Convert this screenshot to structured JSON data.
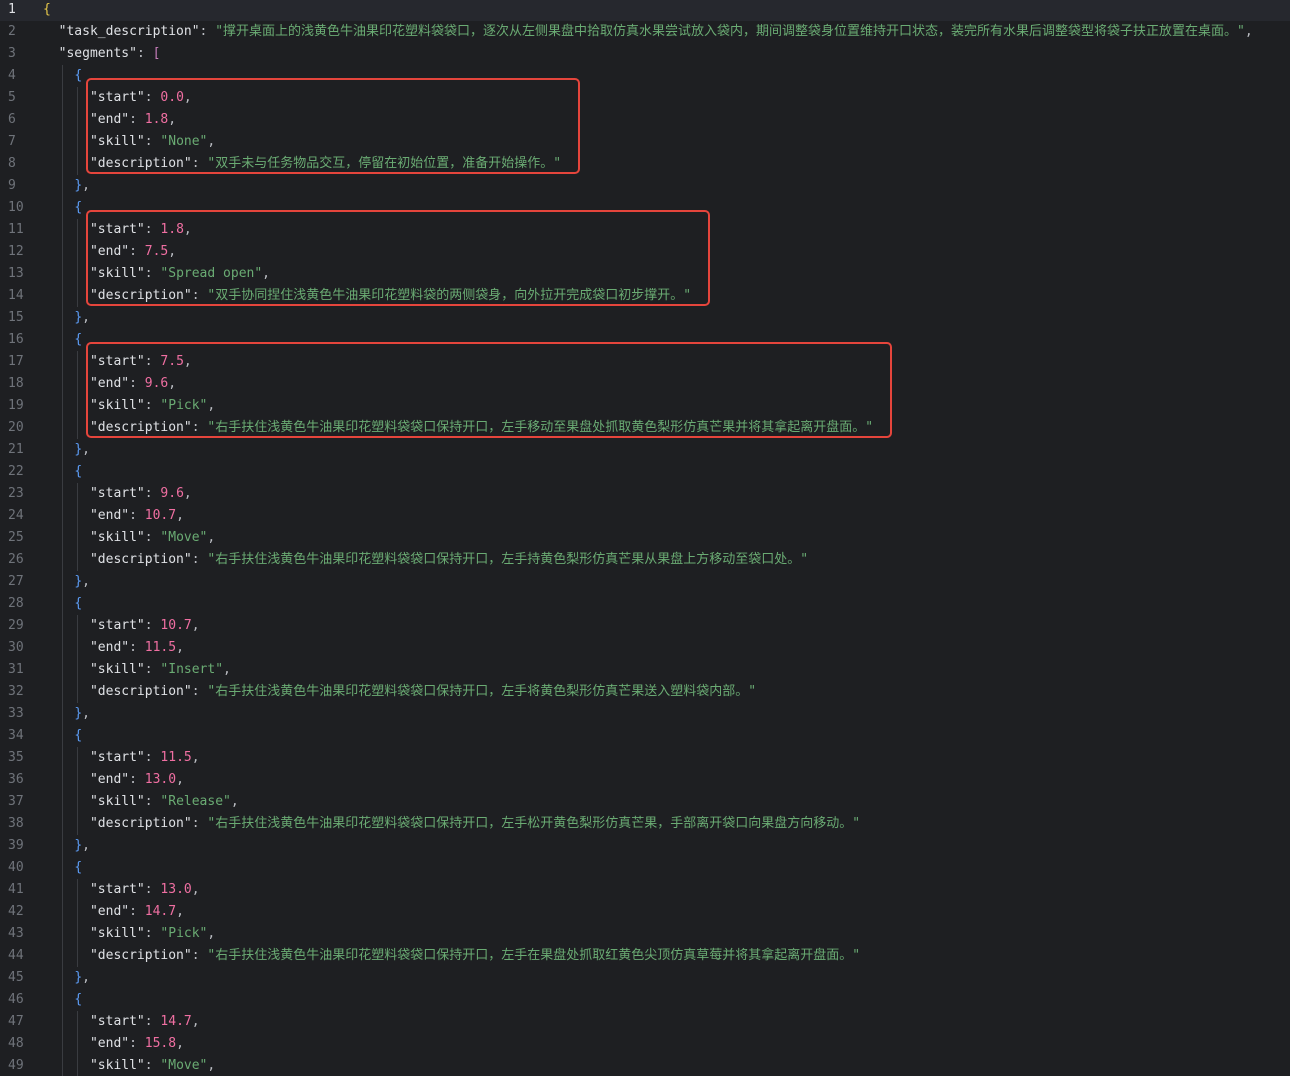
{
  "file": {
    "task_description_key": "task_description",
    "task_description": "撑开桌面上的浅黄色牛油果印花塑料袋袋口，逐次从左侧果盘中拾取仿真水果尝试放入袋内，期间调整袋身位置维持开口状态，装完所有水果后调整袋型将袋子扶正放置在桌面。",
    "segments_key": "segments",
    "segments": [
      {
        "start": "0.0",
        "end": "1.8",
        "skill": "None",
        "description": "双手未与任务物品交互，停留在初始位置，准备开始操作。"
      },
      {
        "start": "1.8",
        "end": "7.5",
        "skill": "Spread open",
        "description": "双手协同捏住浅黄色牛油果印花塑料袋的两侧袋身，向外拉开完成袋口初步撑开。"
      },
      {
        "start": "7.5",
        "end": "9.6",
        "skill": "Pick",
        "description": "右手扶住浅黄色牛油果印花塑料袋袋口保持开口，左手移动至果盘处抓取黄色梨形仿真芒果并将其拿起离开盘面。"
      },
      {
        "start": "9.6",
        "end": "10.7",
        "skill": "Move",
        "description": "右手扶住浅黄色牛油果印花塑料袋袋口保持开口，左手持黄色梨形仿真芒果从果盘上方移动至袋口处。"
      },
      {
        "start": "10.7",
        "end": "11.5",
        "skill": "Insert",
        "description": "右手扶住浅黄色牛油果印花塑料袋袋口保持开口，左手将黄色梨形仿真芒果送入塑料袋内部。"
      },
      {
        "start": "11.5",
        "end": "13.0",
        "skill": "Release",
        "description": "右手扶住浅黄色牛油果印花塑料袋袋口保持开口，左手松开黄色梨形仿真芒果，手部离开袋口向果盘方向移动。"
      },
      {
        "start": "13.0",
        "end": "14.7",
        "skill": "Pick",
        "description": "右手扶住浅黄色牛油果印花塑料袋袋口保持开口，左手在果盘处抓取红黄色尖顶仿真草莓并将其拿起离开盘面。"
      },
      {
        "start": "14.7",
        "end": "15.8",
        "skill": "Move",
        "description": ""
      }
    ],
    "line_numbers": [
      "1",
      "2",
      "3",
      "4",
      "5",
      "6",
      "7",
      "8",
      "9",
      "10",
      "11",
      "12",
      "13",
      "14",
      "15",
      "16",
      "17",
      "18",
      "19",
      "20",
      "21",
      "22",
      "23",
      "24",
      "25",
      "26",
      "27",
      "28",
      "29",
      "30",
      "31",
      "32",
      "33",
      "34",
      "35",
      "36",
      "37",
      "38",
      "39",
      "40",
      "41",
      "42",
      "43",
      "44",
      "45",
      "46",
      "47",
      "48",
      "49"
    ],
    "highlighted_segments": [
      0,
      1,
      2
    ]
  },
  "colors": {
    "background": "#1e1f22",
    "current_line": "#26282e",
    "string": "#6aab73",
    "number": "#f06fa2",
    "highlight_box": "#e5453c",
    "brace_top": "#e6c84a",
    "brace_inner": "#5c9cf5",
    "bracket": "#c77dbb"
  }
}
